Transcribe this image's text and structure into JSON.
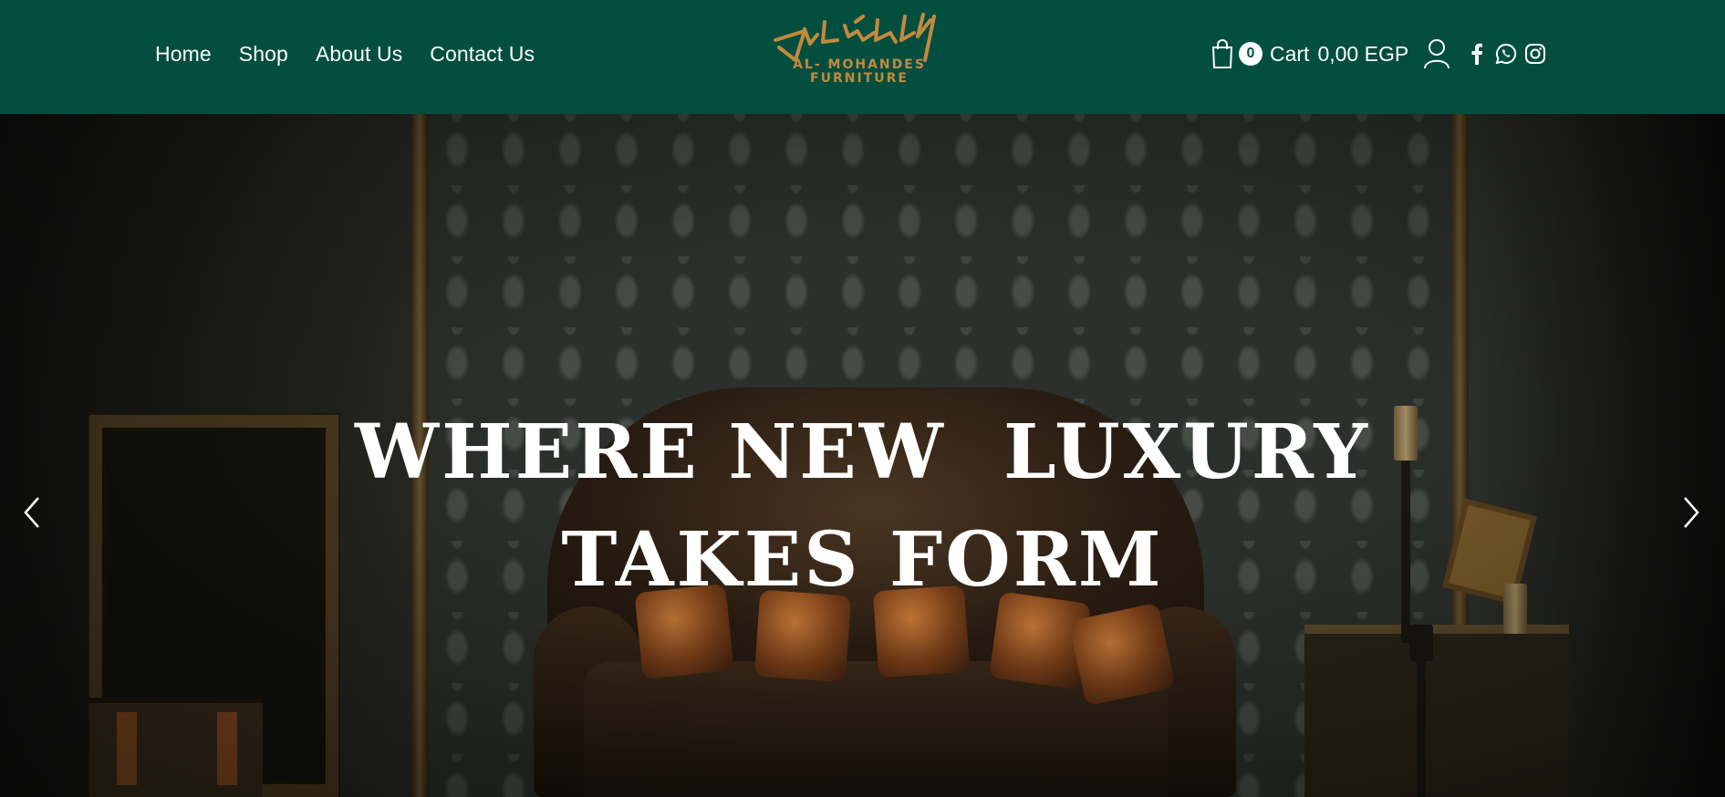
{
  "nav": {
    "items": [
      "Home",
      "Shop",
      "About Us",
      "Contact Us"
    ]
  },
  "logo": {
    "line1": "AL- MOHANDES",
    "line2": "FURNITURE"
  },
  "cart": {
    "count": "0",
    "label": "Cart",
    "amount": "0,00 EGP"
  },
  "icons": {
    "cart": "shopping-bag-icon",
    "account": "user-icon",
    "facebook": "facebook-icon",
    "whatsapp": "whatsapp-icon",
    "instagram": "instagram-icon",
    "prev": "chevron-left-icon",
    "next": "chevron-right-icon"
  },
  "hero": {
    "headline_line1": "WHERE NEW  LUXURY",
    "headline_line2": "TAKES FORM"
  },
  "colors": {
    "header_bg": "#044e40",
    "logo_gold": "#c38a3c",
    "text": "#ffffff"
  }
}
